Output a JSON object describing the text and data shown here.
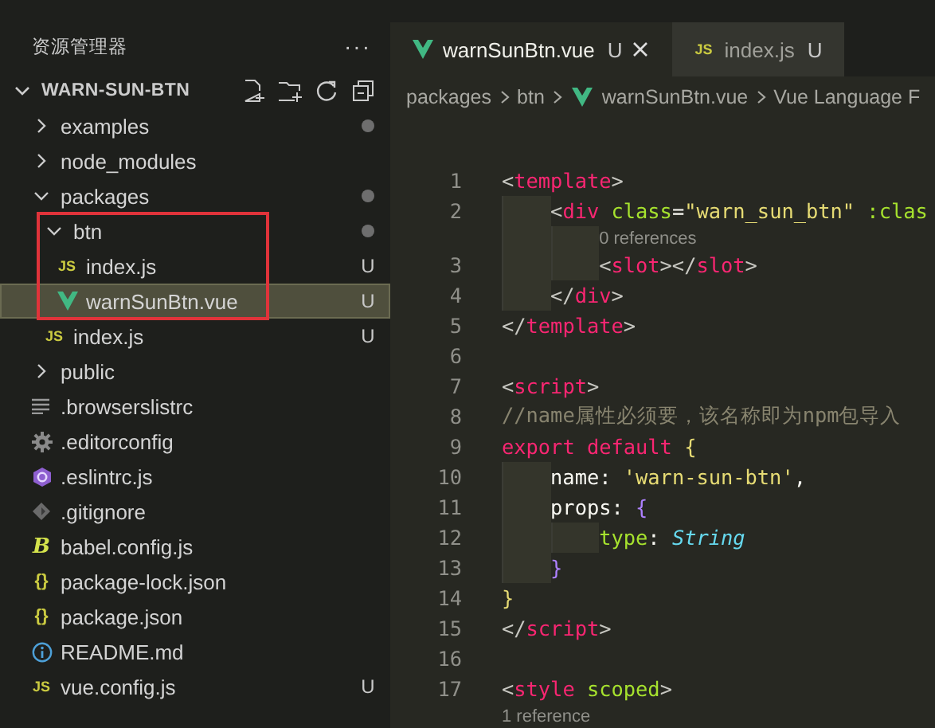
{
  "explorer": {
    "title": "资源管理器",
    "more": "···",
    "section": {
      "title": "WARN-SUN-BTN",
      "expanded": true
    },
    "tree": [
      {
        "label": "examples",
        "kind": "folder",
        "expanded": false,
        "dot": true,
        "selected": false
      },
      {
        "label": "node_modules",
        "kind": "folder",
        "expanded": false,
        "dot": false,
        "selected": false
      },
      {
        "label": "packages",
        "kind": "folder",
        "expanded": true,
        "dot": true,
        "selected": false,
        "children": [
          {
            "label": "btn",
            "kind": "folder",
            "expanded": true,
            "dot": true,
            "selected": false,
            "highlighted": true,
            "children": [
              {
                "label": "index.js",
                "kind": "js",
                "icon_text": "JS",
                "status": "U",
                "selected": false
              },
              {
                "label": "warnSunBtn.vue",
                "kind": "vue",
                "status": "U",
                "selected": true
              }
            ]
          },
          {
            "label": "index.js",
            "kind": "js",
            "icon_text": "JS",
            "status": "U",
            "selected": false
          }
        ]
      },
      {
        "label": "public",
        "kind": "folder",
        "expanded": false,
        "dot": false,
        "selected": false
      },
      {
        "label": ".browserslistrc",
        "kind": "lines",
        "selected": false
      },
      {
        "label": ".editorconfig",
        "kind": "gear",
        "selected": false
      },
      {
        "label": ".eslintrc.js",
        "kind": "eslint",
        "selected": false
      },
      {
        "label": ".gitignore",
        "kind": "git",
        "selected": false
      },
      {
        "label": "babel.config.js",
        "kind": "babel",
        "icon_text": "B",
        "selected": false
      },
      {
        "label": "package-lock.json",
        "kind": "json",
        "icon_text": "{}",
        "selected": false
      },
      {
        "label": "package.json",
        "kind": "json",
        "icon_text": "{}",
        "selected": false
      },
      {
        "label": "README.md",
        "kind": "info",
        "selected": false
      },
      {
        "label": "vue.config.js",
        "kind": "js",
        "icon_text": "JS",
        "status": "U",
        "selected": false
      }
    ]
  },
  "editor": {
    "tabs": [
      {
        "label": "warnSunBtn.vue",
        "kind": "vue",
        "status": "U",
        "selected": true
      },
      {
        "label": "index.js",
        "kind": "js",
        "icon_text": "JS",
        "status": "U",
        "selected": false
      }
    ],
    "breadcrumb": [
      {
        "label": "packages"
      },
      {
        "label": "btn"
      },
      {
        "label": "warnSunBtn.vue",
        "kind": "vue"
      },
      {
        "label": "Vue Language F"
      }
    ],
    "lines": [
      {
        "kind": "code",
        "number": "1",
        "tokens": [
          {
            "t": "<",
            "kind": "punct"
          },
          {
            "t": "template",
            "kind": "tag"
          },
          {
            "t": ">",
            "kind": "punct"
          }
        ],
        "children": [
          {
            "kind": "code",
            "number": "2",
            "tokens": [
              {
                "t": "<",
                "kind": "punct"
              },
              {
                "t": "div",
                "kind": "tag"
              },
              {
                "t": " class",
                "kind": "attr"
              },
              {
                "t": "=",
                "kind": "plain"
              },
              {
                "t": "\"warn_sun_btn\"",
                "kind": "str"
              },
              {
                "t": " :clas",
                "kind": "attr"
              }
            ],
            "children": [
              {
                "kind": "codelens",
                "text": "0 references"
              },
              {
                "kind": "code",
                "number": "3",
                "tokens": [
                  {
                    "t": "<",
                    "kind": "punct"
                  },
                  {
                    "t": "slot",
                    "kind": "tag"
                  },
                  {
                    "t": "></",
                    "kind": "punct"
                  },
                  {
                    "t": "slot",
                    "kind": "tag"
                  },
                  {
                    "t": ">",
                    "kind": "punct"
                  }
                ]
              }
            ]
          },
          {
            "kind": "code",
            "number": "4",
            "tokens": [
              {
                "t": "</",
                "kind": "punct"
              },
              {
                "t": "div",
                "kind": "tag"
              },
              {
                "t": ">",
                "kind": "punct"
              }
            ]
          }
        ]
      },
      {
        "kind": "code",
        "number": "5",
        "tokens": [
          {
            "t": "</",
            "kind": "punct"
          },
          {
            "t": "template",
            "kind": "tag"
          },
          {
            "t": ">",
            "kind": "punct"
          }
        ]
      },
      {
        "kind": "code",
        "number": "6"
      },
      {
        "kind": "code",
        "number": "7",
        "tokens": [
          {
            "t": "<",
            "kind": "punct"
          },
          {
            "t": "script",
            "kind": "tag"
          },
          {
            "t": ">",
            "kind": "punct"
          }
        ]
      },
      {
        "kind": "code",
        "number": "8",
        "tokens": [
          {
            "t": "//name属性必须要，该名称即为npm包导入",
            "kind": "comment"
          }
        ]
      },
      {
        "kind": "code",
        "number": "9",
        "tokens": [
          {
            "t": "export default ",
            "kind": "keyword"
          },
          {
            "t": "{",
            "kind": "brace"
          }
        ],
        "children": [
          {
            "kind": "code",
            "number": "10",
            "tokens": [
              {
                "t": "name: ",
                "kind": "plain"
              },
              {
                "t": "'warn-sun-btn'",
                "kind": "str"
              },
              {
                "t": ",",
                "kind": "plain"
              }
            ]
          },
          {
            "kind": "code",
            "number": "11",
            "tokens": [
              {
                "t": "props: ",
                "kind": "plain"
              },
              {
                "t": "{",
                "kind": "brace2"
              }
            ],
            "children": [
              {
                "kind": "code",
                "number": "12",
                "tokens": [
                  {
                    "t": "type",
                    "kind": "attr"
                  },
                  {
                    "t": ": ",
                    "kind": "plain"
                  },
                  {
                    "t": "String",
                    "kind": "type"
                  }
                ]
              }
            ]
          },
          {
            "kind": "code",
            "number": "13",
            "tokens": [
              {
                "t": "}",
                "kind": "brace2"
              }
            ]
          }
        ]
      },
      {
        "kind": "code",
        "number": "14",
        "tokens": [
          {
            "t": "}",
            "kind": "brace"
          }
        ]
      },
      {
        "kind": "code",
        "number": "15",
        "tokens": [
          {
            "t": "</",
            "kind": "punct"
          },
          {
            "t": "script",
            "kind": "tag"
          },
          {
            "t": ">",
            "kind": "punct"
          }
        ]
      },
      {
        "kind": "code",
        "number": "16"
      },
      {
        "kind": "code",
        "number": "17",
        "tokens": [
          {
            "t": "<",
            "kind": "punct"
          },
          {
            "t": "style",
            "kind": "tag"
          },
          {
            "t": " scoped",
            "kind": "attr"
          },
          {
            "t": ">",
            "kind": "punct"
          }
        ]
      },
      {
        "kind": "codelens",
        "text": "1 reference"
      }
    ]
  }
}
